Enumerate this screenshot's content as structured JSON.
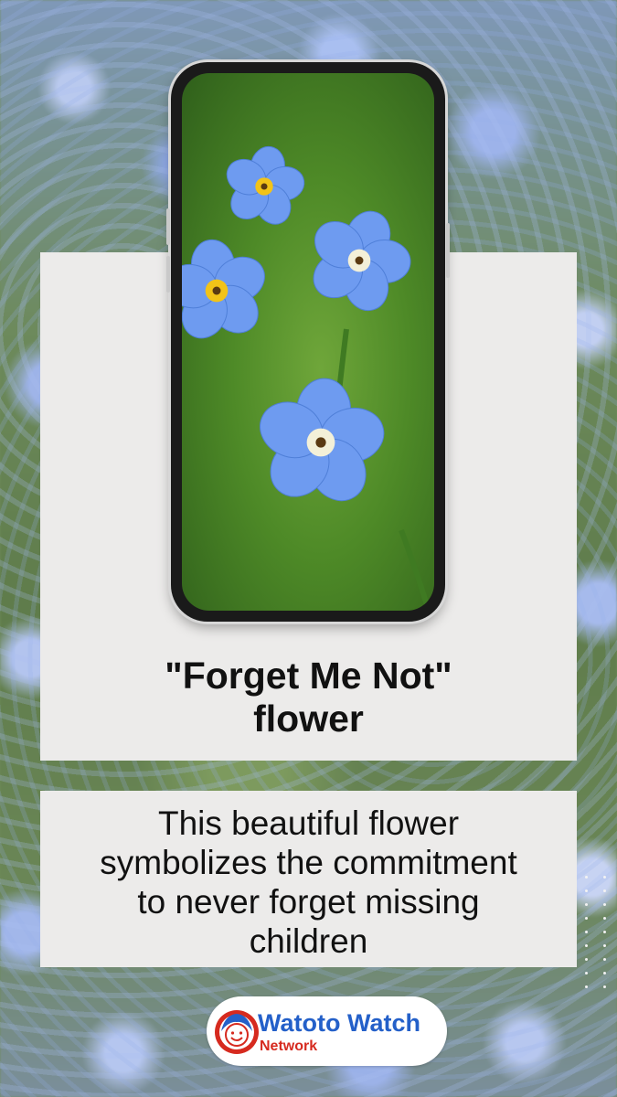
{
  "title": {
    "line1": "\"Forget Me Not\"",
    "line2": "flower"
  },
  "description": {
    "line1": "This beautiful flower",
    "line2": "symbolizes the commitment",
    "line3": "to never forget missing",
    "line4": "children"
  },
  "logo": {
    "name": "Watoto Watch",
    "subtitle": "Network"
  },
  "colors": {
    "panel": "#ecebea",
    "logo_blue": "#2460c9",
    "logo_red": "#d62a1f",
    "petal": "#6e9bf0"
  }
}
